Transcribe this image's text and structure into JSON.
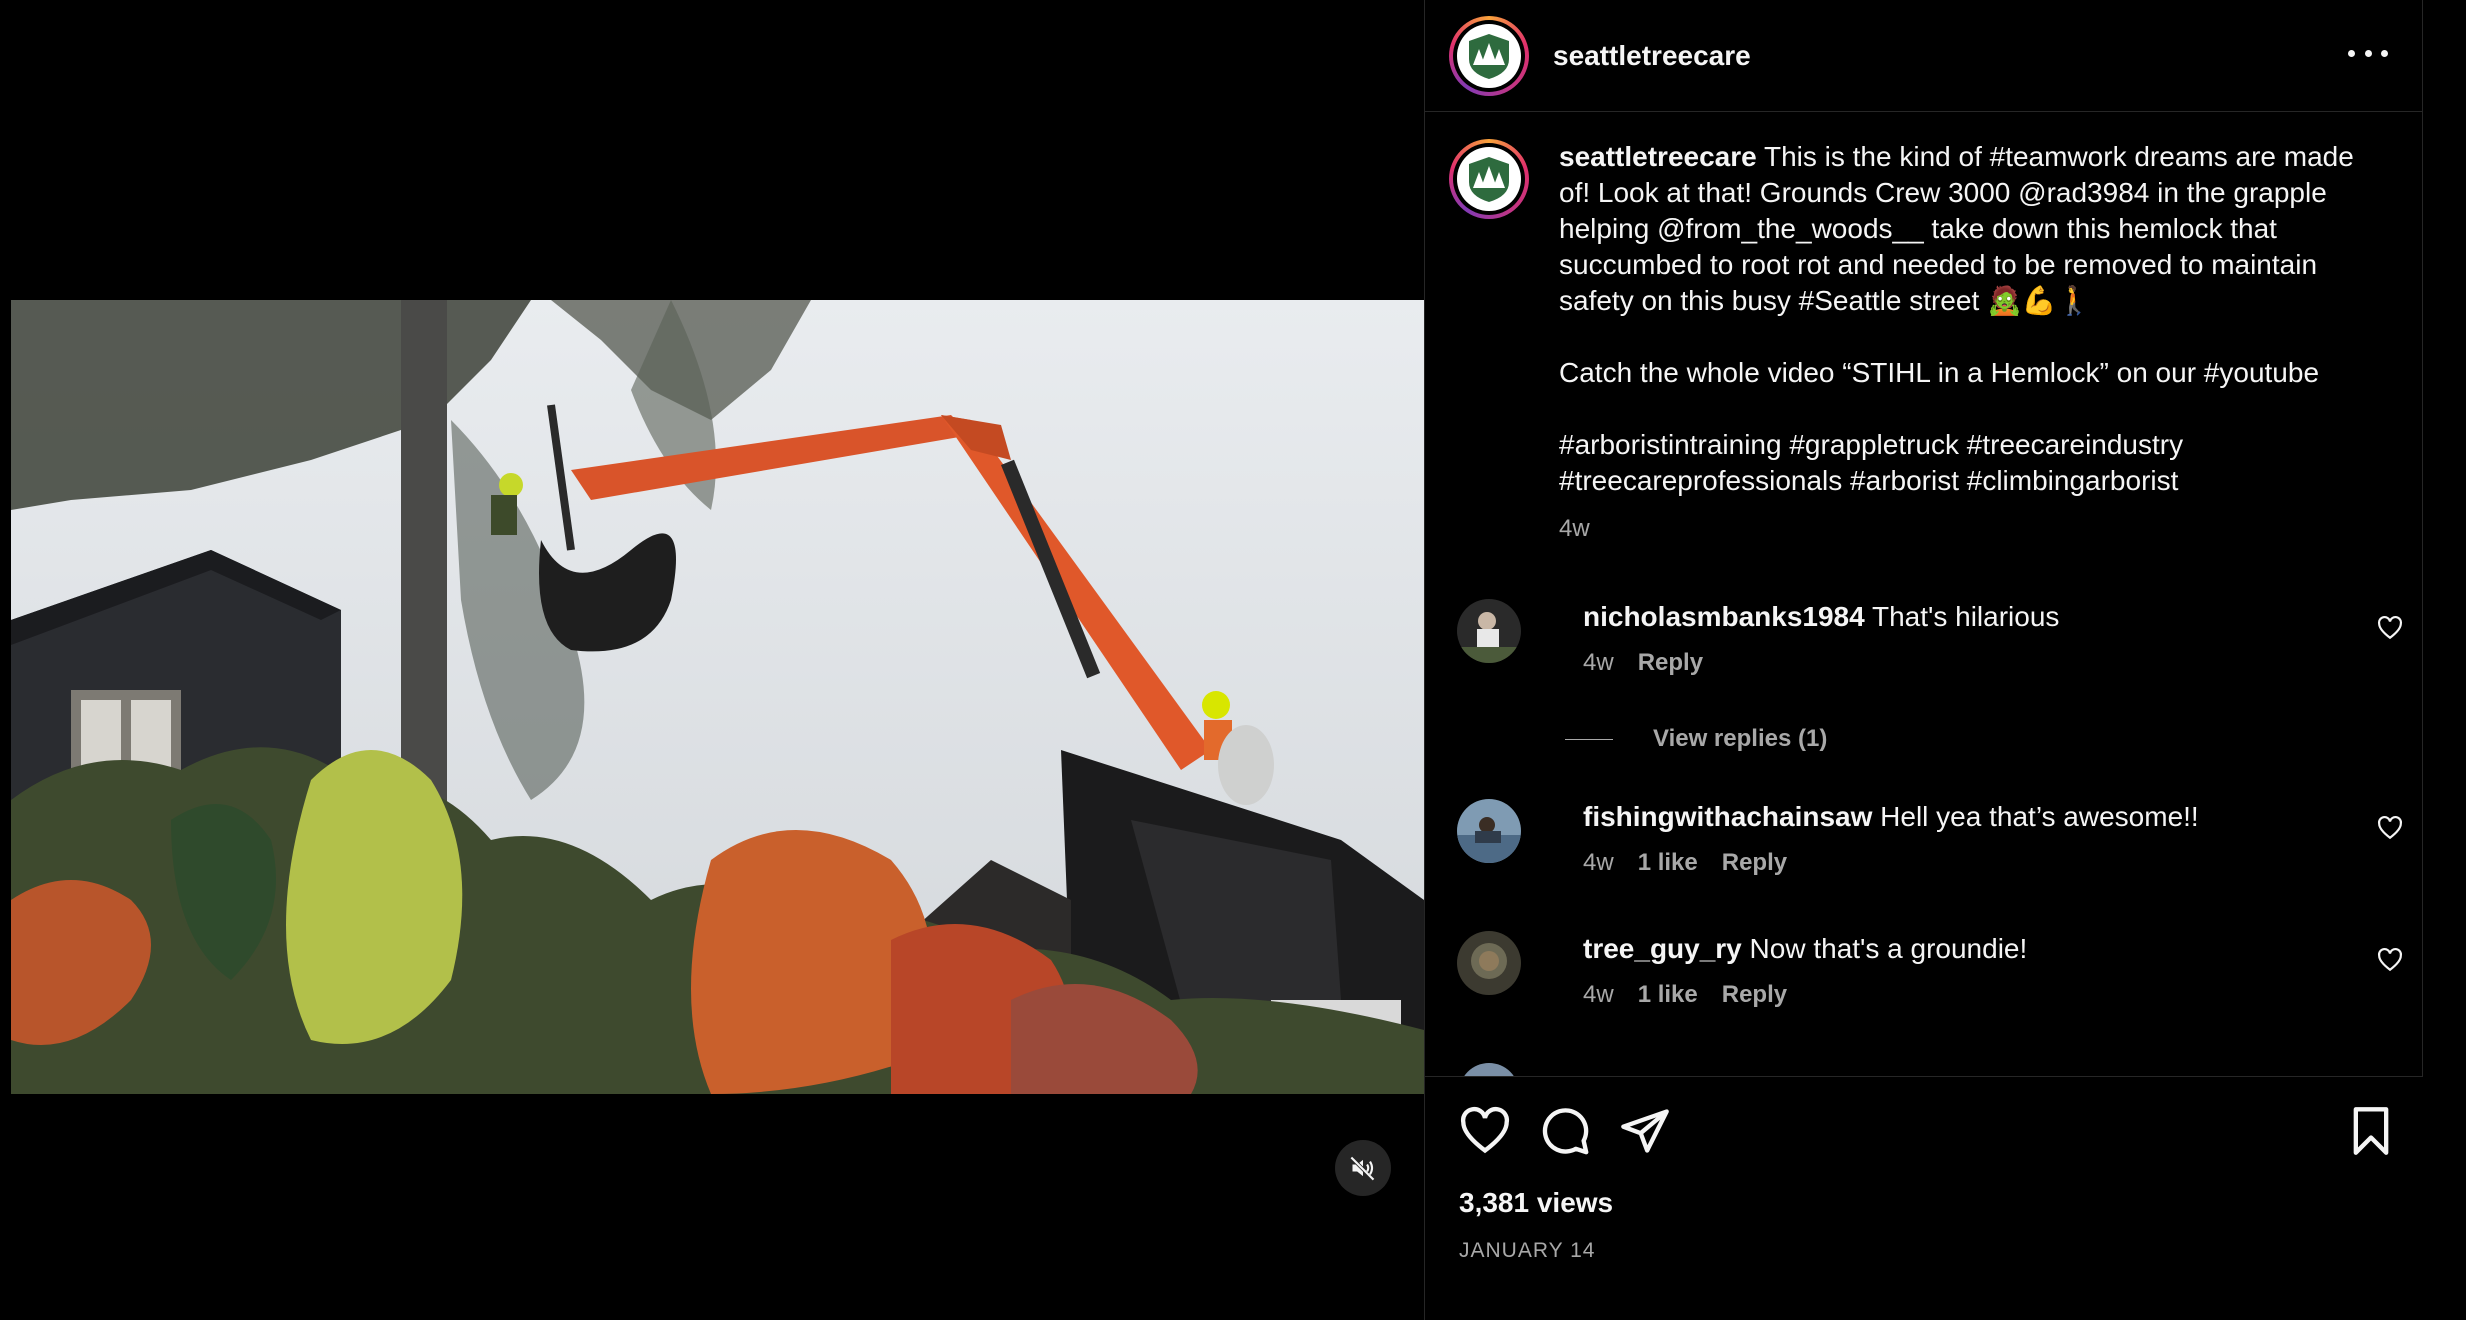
{
  "post": {
    "username": "seattletreecare",
    "caption": {
      "username": "seattletreecare",
      "text": " This is the kind of #teamwork dreams are made of! Look at that! Grounds Crew 3000 @rad3984 in the grapple helping @from_the_woods__ take down this hemlock that succumbed to root rot and needed to be removed to maintain safety on this busy #Seattle street 🧟💪🚶",
      "text2": "Catch the whole video “STIHL in a Hemlock” on our #youtube",
      "text3": "#arboristintraining #grappletruck #treecareindustry #treecareprofessionals #arborist #climbingarborist",
      "time": "4w"
    },
    "comments": [
      {
        "username": "nicholasmbanks1984",
        "text": "That's hilarious",
        "time": "4w",
        "likes": "",
        "reply": "Reply",
        "view_replies": "View replies (1)"
      },
      {
        "username": "fishingwithachainsaw",
        "text": "Hell yea that’s awesome!!",
        "time": "4w",
        "likes": "1 like",
        "reply": "Reply"
      },
      {
        "username": "tree_guy_ry",
        "text": "Now that's a groundie!",
        "time": "4w",
        "likes": "1 like",
        "reply": "Reply"
      }
    ],
    "views": "3,381 views",
    "date": "JANUARY 14"
  },
  "icons": {
    "more": "more-options-icon",
    "mute": "muted-speaker-icon",
    "like": "heart-icon",
    "comment": "comment-bubble-icon",
    "share": "paper-plane-icon",
    "save": "bookmark-icon"
  },
  "colors": {
    "background": "#000000",
    "text": "#f5f5f5",
    "muted": "#a8a8a8",
    "border": "#262626",
    "crane_orange": "#e0582a"
  }
}
